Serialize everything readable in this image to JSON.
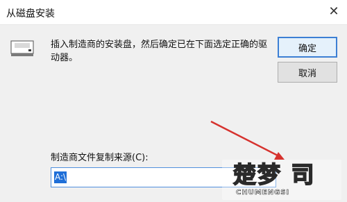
{
  "window": {
    "title": "从磁盘安装",
    "close_glyph": "✕"
  },
  "dialog": {
    "icon": "floppy-disk-icon",
    "message": "插入制造商的安装盘，然后确定已在下面选定正确的驱动器。",
    "ok_label": "确定",
    "cancel_label": "取消",
    "source_label": "制造商文件复制来源(C):",
    "source_value": "A:\\",
    "source_value_selected": "A:\\"
  },
  "annotation": {
    "arrow_color": "#d6322e"
  },
  "watermark": {
    "title": "楚梦 司",
    "subtitle": "CHUMENGSI"
  },
  "colors": {
    "accent": "#3c7fd4",
    "selection": "#1f6fd8"
  }
}
